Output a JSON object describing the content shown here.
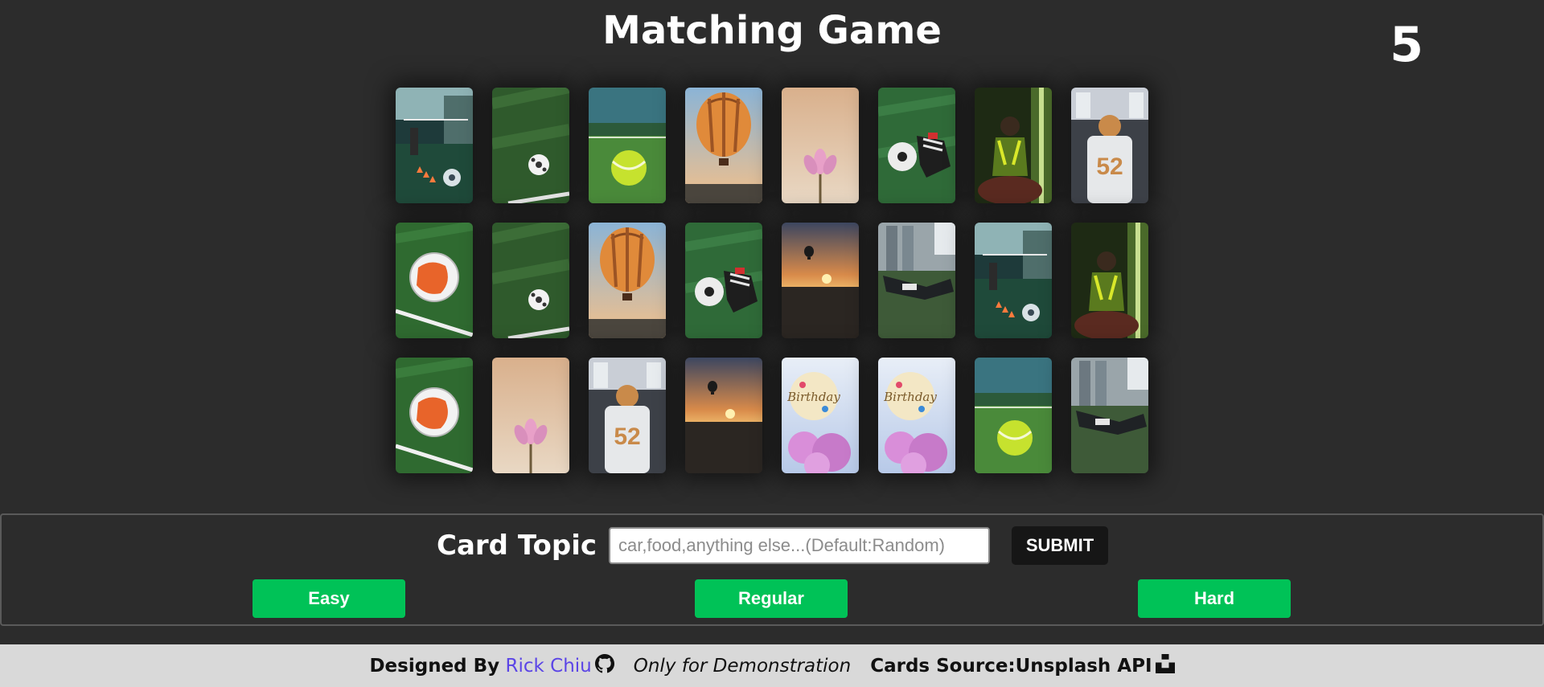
{
  "header": {
    "title": "Matching Game",
    "score": "5"
  },
  "board": {
    "rows": 3,
    "columns": 8,
    "cards": [
      "soccer-training-cones",
      "soccer-ball-on-grass",
      "tennis-ball",
      "hot-air-balloon",
      "pink-lotus-flower",
      "soccer-cleats-and-ball",
      "person-in-green-room",
      "football-player-52",
      "orange-soccer-ball",
      "soccer-ball-on-grass",
      "hot-air-balloon",
      "soccer-cleats-and-ball",
      "sunset-balloon",
      "player-lying-on-grass",
      "soccer-training-cones",
      "person-in-green-room",
      "orange-soccer-ball",
      "pink-lotus-flower",
      "football-player-52",
      "sunset-balloon",
      "birthday-balloons",
      "birthday-balloons",
      "tennis-ball",
      "player-lying-on-grass"
    ]
  },
  "controls": {
    "topic_label": "Card Topic",
    "topic_placeholder": "car,food,anything else...(Default:Random)",
    "submit_label": "SUBMIT",
    "easy_label": "Easy",
    "regular_label": "Regular",
    "hard_label": "Hard"
  },
  "footer": {
    "designed_by": "Designed By",
    "author": "Rick Chiu",
    "demo_note": "Only for Demonstration",
    "source": "Cards Source:Unsplash API"
  },
  "colors": {
    "background": "#2c2c2c",
    "level_button": "#00c257",
    "author_link": "#5b45e6",
    "footer_bg": "#d9d9d9"
  },
  "icons": {
    "author": "github-icon",
    "source": "unsplash-icon"
  }
}
